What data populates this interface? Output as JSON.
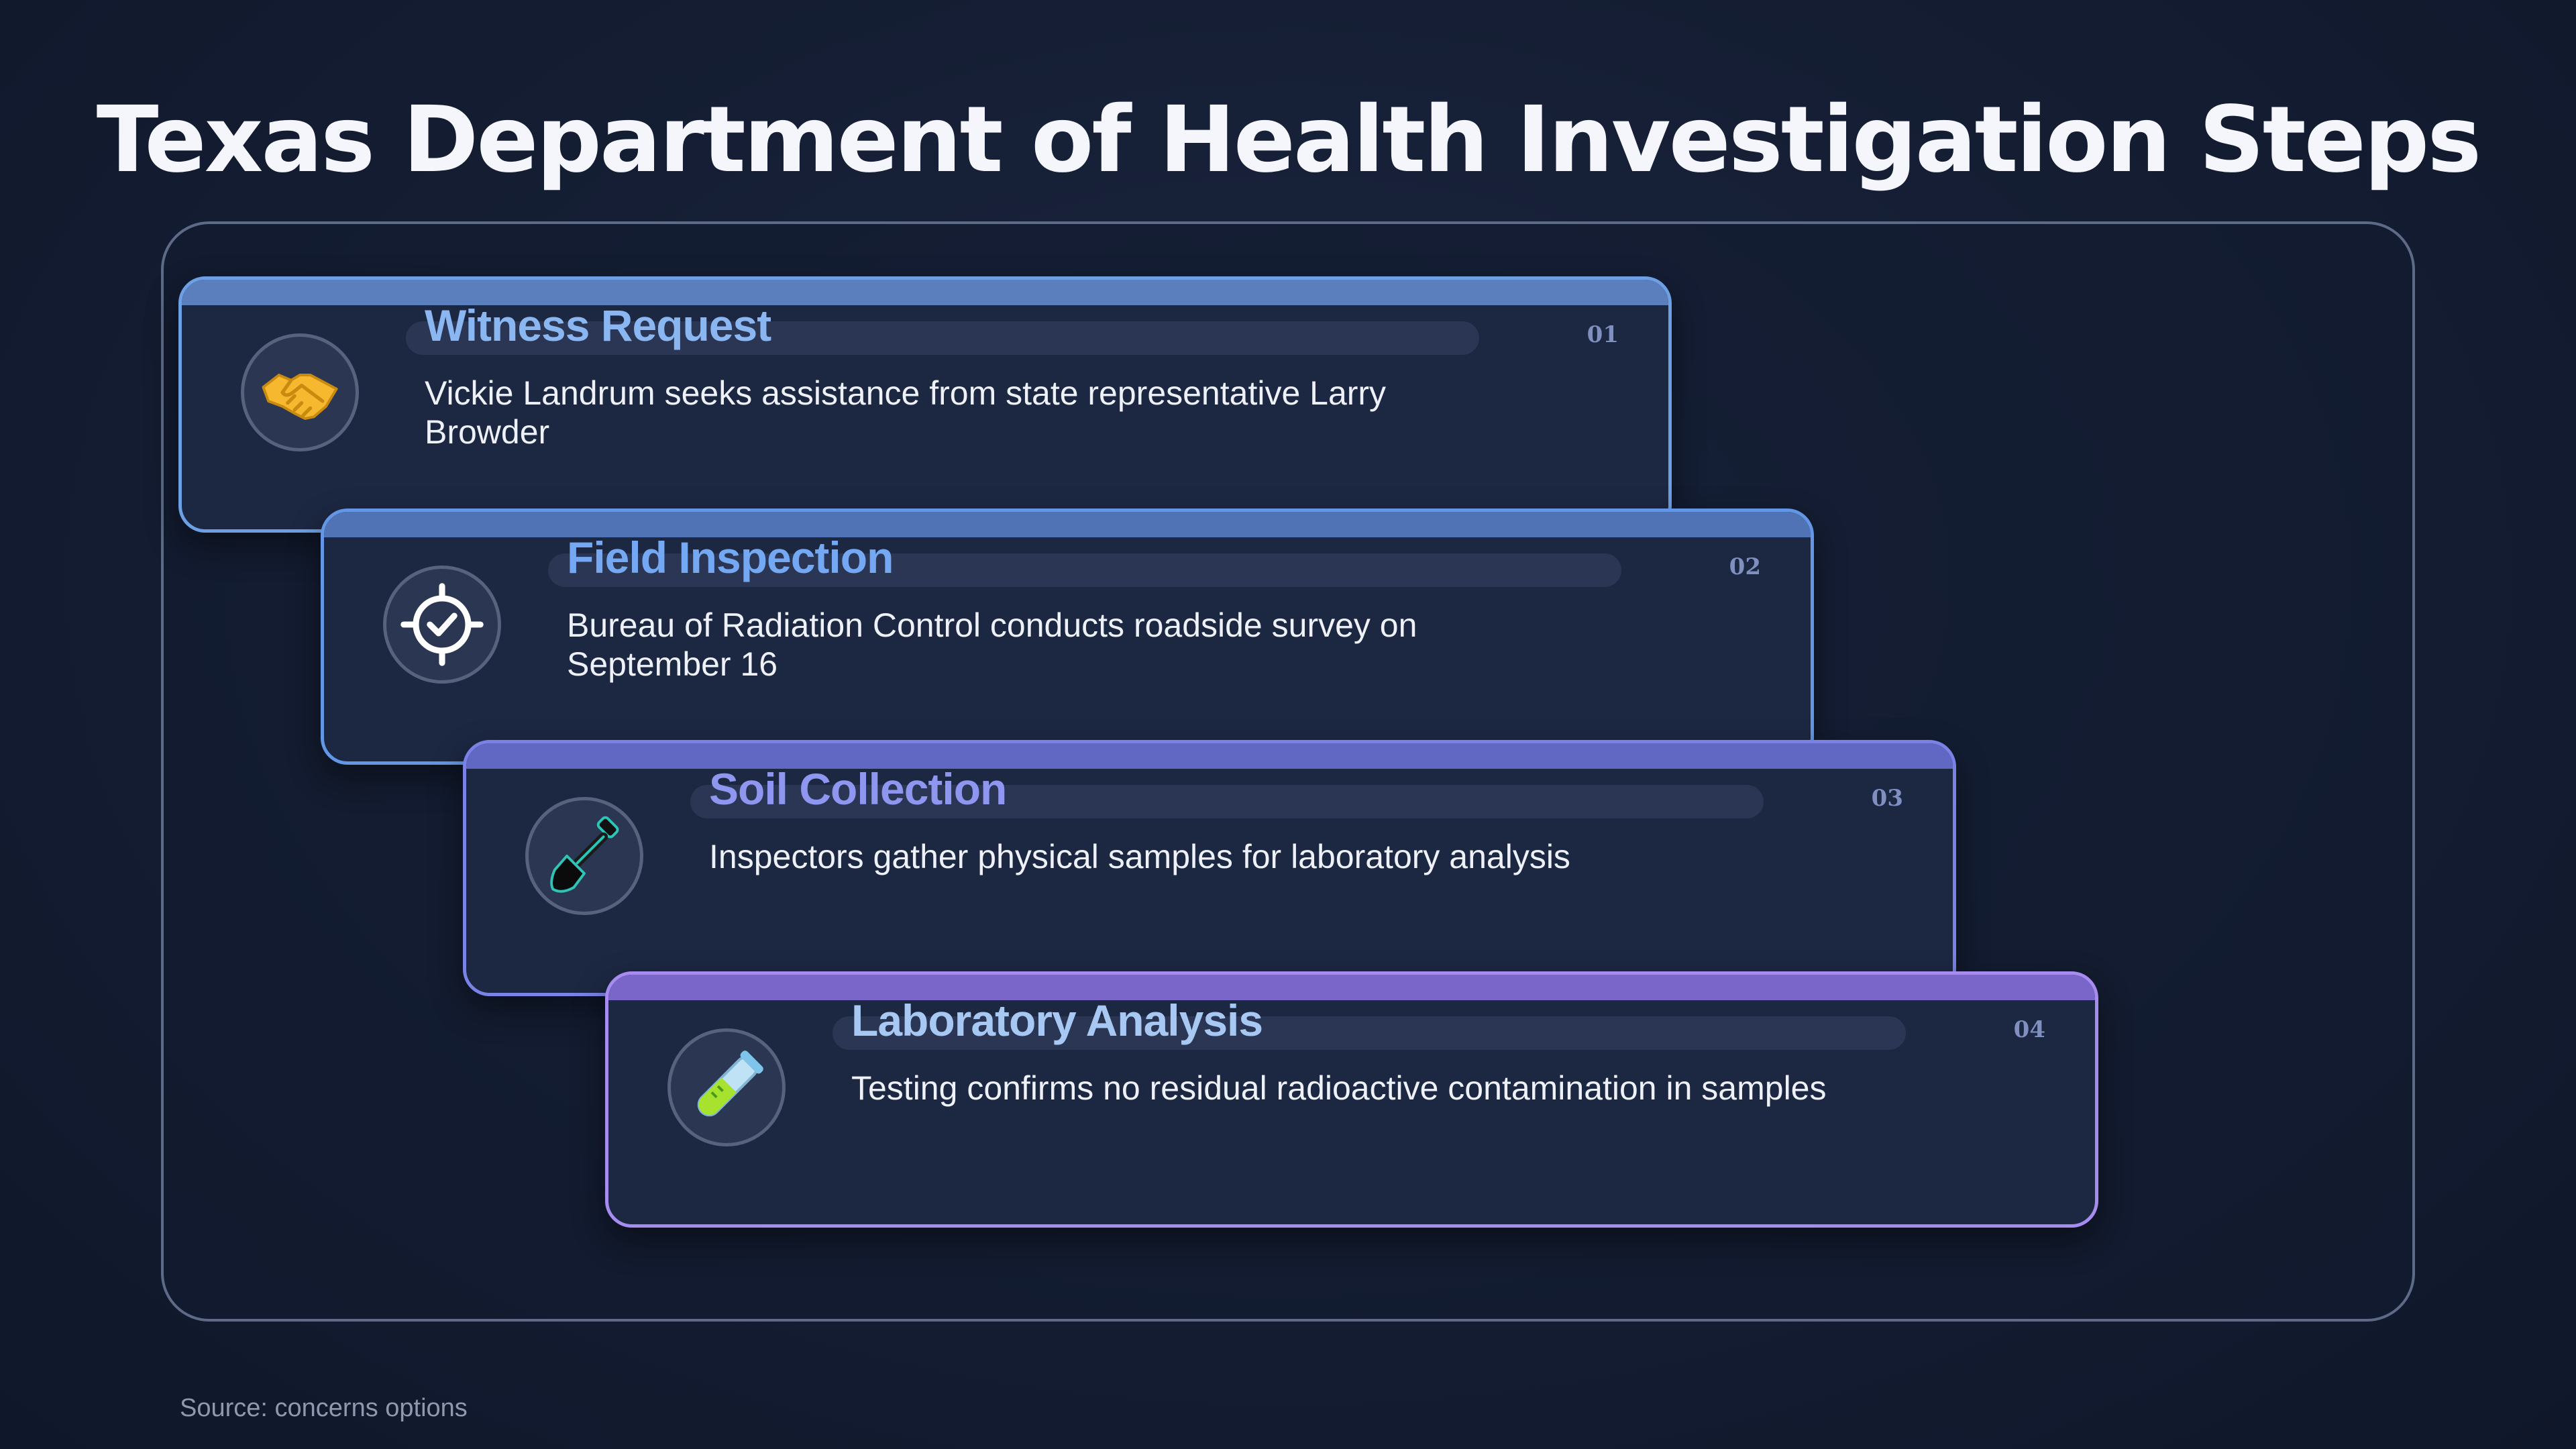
{
  "title": "Texas Department of Health Investigation Steps",
  "steps": [
    {
      "number": "01",
      "title": "Witness Request",
      "description": "Vickie Landrum seeks assistance from state representative Larry Browder",
      "icon": "handshake-icon"
    },
    {
      "number": "02",
      "title": "Field Inspection",
      "description": "Bureau of Radiation Control conducts roadside survey on September 16",
      "icon": "target-check-icon"
    },
    {
      "number": "03",
      "title": "Soil Collection",
      "description": "Inspectors gather physical samples for laboratory analysis",
      "icon": "shovel-icon"
    },
    {
      "number": "04",
      "title": "Laboratory Analysis",
      "description": "Testing confirms no residual radioactive contamination in samples",
      "icon": "test-tube-icon"
    }
  ],
  "source": "Source: concerns options",
  "colors": {
    "background": "#141d32",
    "card": "#1c2742",
    "step1_accent": "#6d9fe3",
    "step2_accent": "#6397e6",
    "step3_accent": "#7b82e6",
    "step4_accent": "#a78cf0"
  }
}
